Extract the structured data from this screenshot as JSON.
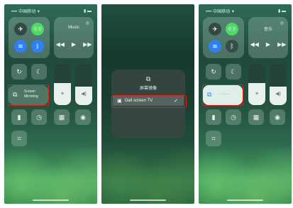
{
  "panels": [
    {
      "status": {
        "left": "•••• 中国移动 ✦",
        "right": "▮ ▬"
      },
      "media": {
        "title": "Music",
        "prev": "◀◀",
        "play": "▶",
        "next": "▶▶",
        "airplay": "◎"
      },
      "mirroring": {
        "icon": "⧉",
        "label": "Screen Mirroring",
        "selected": false
      },
      "brightness_level": 0.54,
      "volume_level": 0.45
    },
    {
      "sheet": {
        "icon": "⧉",
        "title": "屏幕镜像",
        "device": {
          "icon": "▣",
          "name": "Oall screen TV",
          "check": "✓"
        }
      }
    },
    {
      "status": {
        "left": "•••• 中国移动 ✦",
        "right": "▮ ▬"
      },
      "media": {
        "title": "音乐",
        "prev": "◀◀",
        "play": "▶",
        "next": "▶▶",
        "airplay": "◎"
      },
      "mirroring": {
        "icon": "⧉",
        "label": "·· ·······",
        "selected": true
      },
      "brightness_level": 0.54,
      "volume_level": 0.45
    }
  ],
  "icons": {
    "airplane": "✈",
    "cellular": "((·))",
    "wifi": "≋",
    "bluetooth": "ᛒ",
    "rotation_lock": "↻",
    "do_not_disturb": "☾",
    "brightness": "☀",
    "volume": "◀)",
    "flashlight": "▮",
    "timer": "◷",
    "calculator": "▦",
    "camera": "◉",
    "scanner": "⌗"
  },
  "colors": {
    "accent_blue": "#2f7ff6",
    "cellular_green": "#4cd964",
    "highlight_red": "#e0241c"
  }
}
